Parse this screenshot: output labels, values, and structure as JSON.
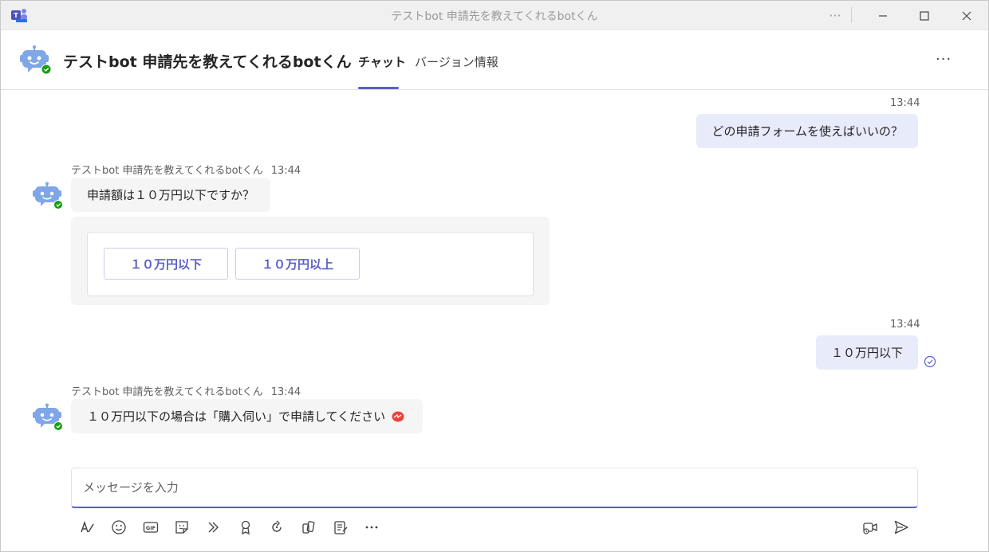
{
  "window": {
    "title": "テストbot 申請先を教えてくれるbotくん",
    "more_label": "···",
    "minimize_label": "—",
    "maximize_label": "☐",
    "close_label": "✕"
  },
  "header": {
    "bot_name": "テストbot 申請先を教えてくれるbotくん",
    "tabs": [
      {
        "label": "チャット",
        "active": true
      },
      {
        "label": "バージョン情報",
        "active": false
      }
    ],
    "more_label": "···"
  },
  "colors": {
    "accent": "#5b5fc7",
    "bot_avatar": "#7fa6e6",
    "online_badge": "#13a10e",
    "outgoing_bubble": "#e8ebfa",
    "incoming_bubble": "#f5f5f5"
  },
  "messages": [
    {
      "direction": "out",
      "time": "13:44",
      "text": "どの申請フォームを使えばいいの？"
    },
    {
      "direction": "in",
      "sender": "テストbot 申請先を教えてくれるbotくん",
      "time": "13:44",
      "text": "申請額は１０万円以下ですか？",
      "card_buttons": [
        "１０万円以下",
        "１０万円以上"
      ]
    },
    {
      "direction": "out",
      "time": "13:44",
      "text": "１０万円以下"
    },
    {
      "direction": "in",
      "sender": "テストbot 申請先を教えてくれるbotくん",
      "time": "13:44",
      "text": "１０万円以下の場合は「購入伺い」で申請してください"
    }
  ],
  "compose": {
    "placeholder": "メッセージを入力"
  },
  "toolbar": {
    "icons": [
      "format-icon",
      "emoji-icon",
      "gif-icon",
      "sticker-icon",
      "meet-icon",
      "praise-icon",
      "loop-icon",
      "apps-icon",
      "forms-icon",
      "more-options-icon",
      "video-clip-icon",
      "send-icon"
    ]
  }
}
